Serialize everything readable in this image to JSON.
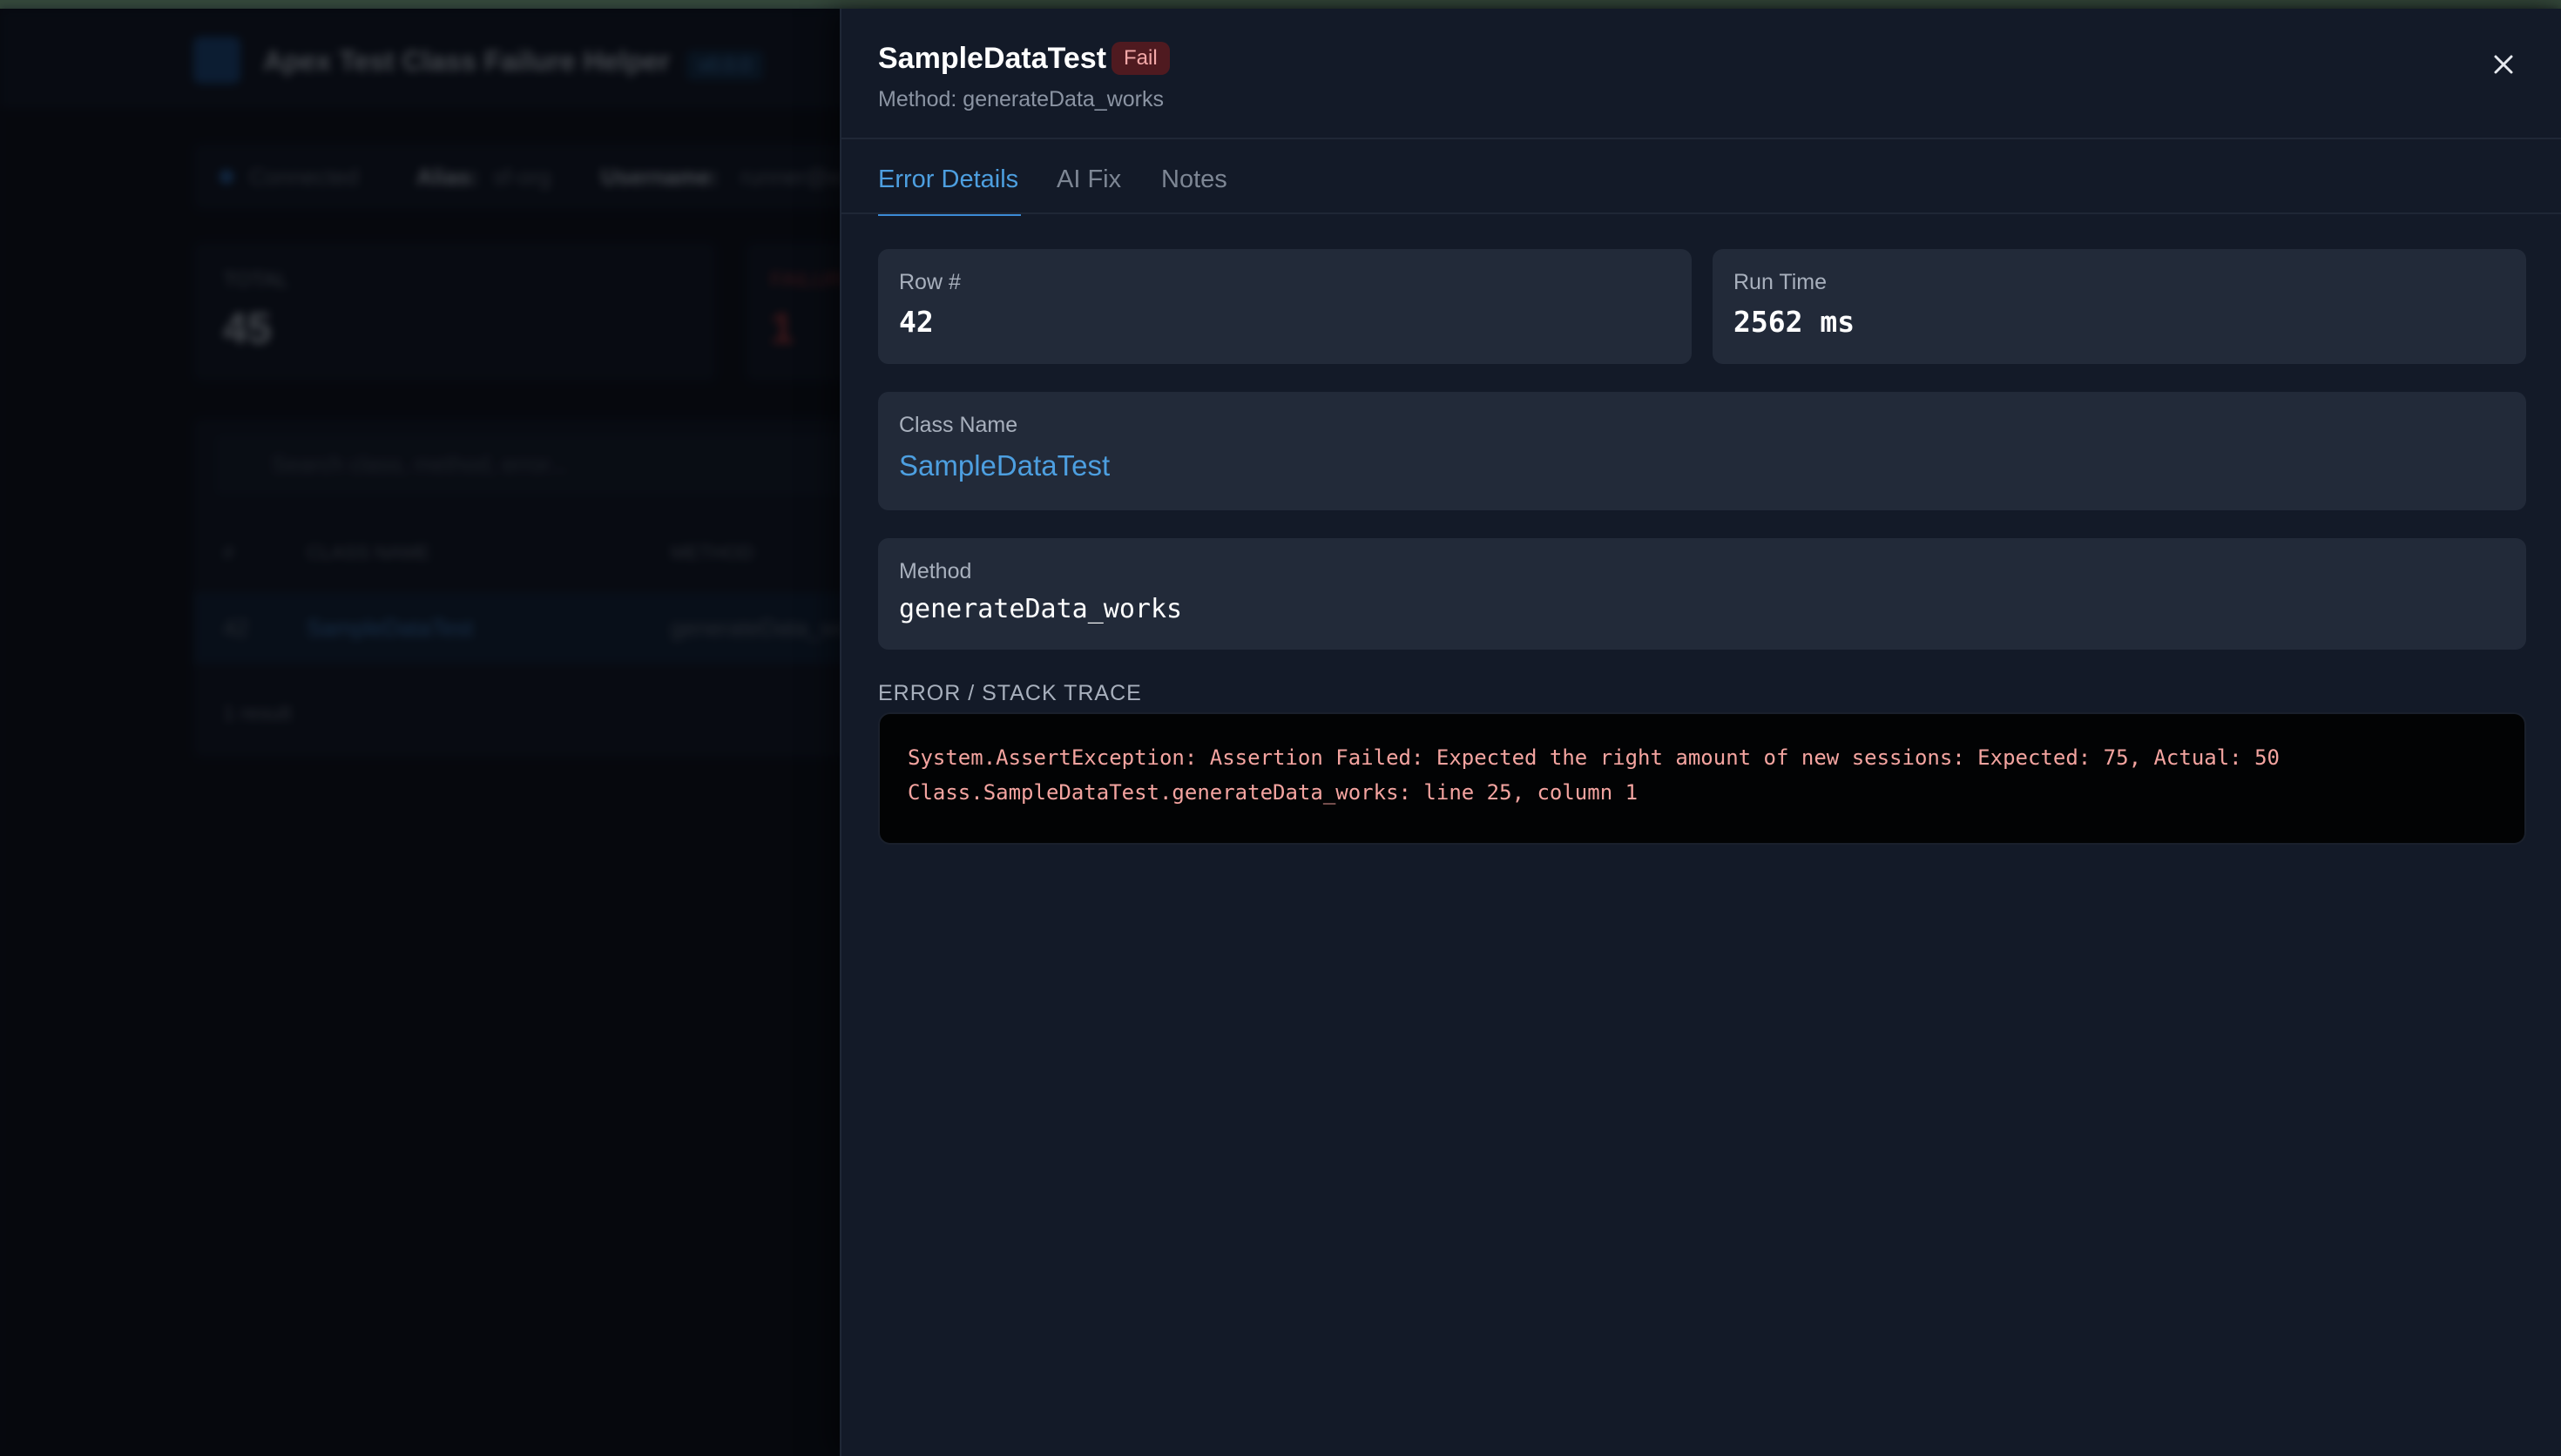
{
  "background": {
    "app_title": "Apex Test Class Failure Helper",
    "version": "v0.0.0",
    "connection": {
      "status": "Connected",
      "alias_label": "Alias:",
      "alias_value": "sf-org",
      "username_label": "Username:",
      "username_value": "runner@example.com"
    },
    "stats": [
      {
        "label": "TOTAL",
        "value": "45"
      },
      {
        "label": "FAILURES",
        "value": "1"
      }
    ],
    "search_placeholder": "Search class, method, error...",
    "table": {
      "headers": [
        "#",
        "CLASS NAME",
        "METHOD"
      ],
      "rows": [
        {
          "num": "42",
          "class_name": "SampleDataTest",
          "method": "generateData_works"
        }
      ],
      "results": "1 result"
    }
  },
  "panel": {
    "title": "SampleDataTest",
    "badge": "Fail",
    "subtitle_label": "Method:",
    "subtitle_value": "generateData_works",
    "close_label": "×",
    "tabs": [
      {
        "label": "Error Details",
        "active": true
      },
      {
        "label": "AI Fix",
        "active": false
      },
      {
        "label": "Notes",
        "active": false
      }
    ],
    "row": {
      "label": "Row #",
      "value": "42"
    },
    "run_time": {
      "label": "Run Time",
      "value": "2562 ms"
    },
    "class_name": {
      "label": "Class Name",
      "value": "SampleDataTest"
    },
    "method": {
      "label": "Method",
      "value": "generateData_works"
    },
    "stack_title": "ERROR / STACK TRACE",
    "stack_lines": [
      "System.AssertException: Assertion Failed: Expected the right amount of new sessions: Expected: 75, Actual: 50",
      "Class.SampleDataTest.generateData_works: line 25, column 1"
    ]
  },
  "colors": {
    "accent": "#4d9fe0",
    "fail_badge_bg": "#4f1a20",
    "fail_badge_text": "#f3a8a8",
    "stack_text": "#f4a4a0",
    "panel_bg": "#131a28",
    "card_bg": "#222a39"
  },
  "icons": {
    "close": "close-icon",
    "search": "search-icon",
    "logo": "app-logo-icon",
    "status": "status-dot-icon"
  }
}
